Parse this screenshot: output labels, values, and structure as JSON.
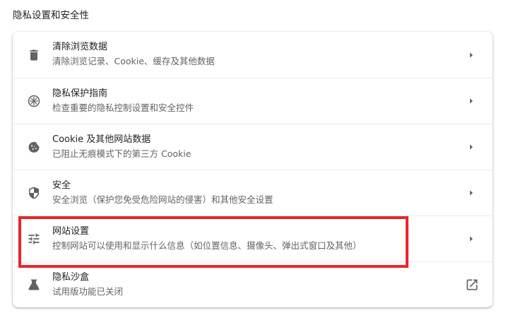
{
  "section_title": "隐私设置和安全性",
  "rows": [
    {
      "label": "清除浏览数据",
      "sublabel": "清除浏览记录、Cookie、缓存及其他数据",
      "icon": "trash-icon",
      "action": "chevron-right-icon"
    },
    {
      "label": "隐私保护指南",
      "sublabel": "检查重要的隐私控制设置和安全控件",
      "icon": "privacy-guide-icon",
      "action": "chevron-right-icon"
    },
    {
      "label": "Cookie 及其他网站数据",
      "sublabel": "已阻止无痕模式下的第三方 Cookie",
      "icon": "cookie-icon",
      "action": "chevron-right-icon"
    },
    {
      "label": "安全",
      "sublabel": "安全浏览（保护您免受危险网站的侵害）和其他安全设置",
      "icon": "shield-icon",
      "action": "chevron-right-icon"
    },
    {
      "label": "网站设置",
      "sublabel": "控制网站可以使用和显示什么信息（如位置信息、摄像头、弹出式窗口及其他）",
      "icon": "tune-icon",
      "action": "chevron-right-icon"
    },
    {
      "label": "隐私沙盒",
      "sublabel": "试用版功能已关闭",
      "icon": "flask-icon",
      "action": "open-in-new-icon"
    }
  ],
  "colors": {
    "text_primary": "#202124",
    "text_secondary": "#5f6368",
    "icon": "#5f6368",
    "divider": "#e8eaed",
    "highlight_border": "#e8262b"
  }
}
